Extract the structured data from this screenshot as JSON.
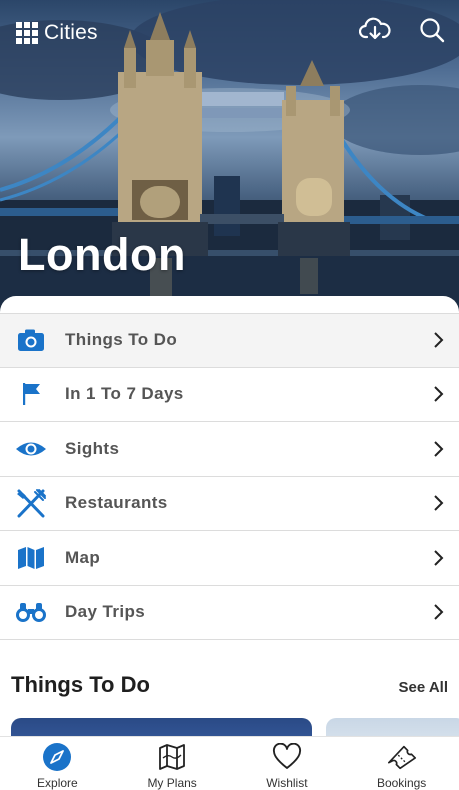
{
  "topbar": {
    "cities_label": "Cities",
    "download_icon": "cloud-download-icon",
    "search_icon": "search-icon"
  },
  "hero": {
    "city_name": "London",
    "image": "tower-bridge-dusk-photo"
  },
  "menu": {
    "items": [
      {
        "label": "Things To Do",
        "icon": "camera-icon"
      },
      {
        "label": "In 1 To 7 Days",
        "icon": "flag-icon"
      },
      {
        "label": "Sights",
        "icon": "eye-icon"
      },
      {
        "label": "Restaurants",
        "icon": "fork-knife-icon"
      },
      {
        "label": "Map",
        "icon": "map-icon"
      },
      {
        "label": "Day Trips",
        "icon": "binoculars-icon"
      }
    ]
  },
  "things_section": {
    "title": "Things To Do",
    "see_all": "See All"
  },
  "bottom_nav": {
    "items": [
      {
        "label": "Explore",
        "icon": "compass-icon",
        "active": true
      },
      {
        "label": "My Plans",
        "icon": "map-icon"
      },
      {
        "label": "Wishlist",
        "icon": "heart-icon"
      },
      {
        "label": "Bookings",
        "icon": "ticket-icon"
      }
    ]
  },
  "colors": {
    "accent_blue": "#1a73c9",
    "menu_text": "#555555",
    "nav_text": "#333333"
  }
}
